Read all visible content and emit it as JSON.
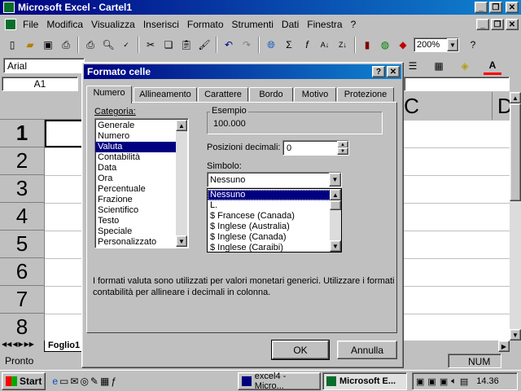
{
  "app": {
    "title": "Microsoft Excel - Cartel1"
  },
  "menu": [
    "File",
    "Modifica",
    "Visualizza",
    "Inserisci",
    "Formato",
    "Strumenti",
    "Dati",
    "Finestra",
    "?"
  ],
  "toolbar": {
    "zoom": "200%"
  },
  "formatbar": {
    "font": "Arial"
  },
  "namebox": "A1",
  "columns": [
    "C",
    "D"
  ],
  "rows": [
    "1",
    "2",
    "3",
    "4",
    "5",
    "6",
    "7",
    "8"
  ],
  "sheet_tab": "Foglio1",
  "statusbar": {
    "left": "Pronto",
    "num": "NUM"
  },
  "dialog": {
    "title": "Formato celle",
    "tabs": [
      "Numero",
      "Allineamento",
      "Carattere",
      "Bordo",
      "Motivo",
      "Protezione"
    ],
    "category_label": "Categoria:",
    "categories": [
      "Generale",
      "Numero",
      "Valuta",
      "Contabilità",
      "Data",
      "Ora",
      "Percentuale",
      "Frazione",
      "Scientifico",
      "Testo",
      "Speciale",
      "Personalizzato"
    ],
    "example_label": "Esempio",
    "example_value": "100.000",
    "decimals_label": "Posizioni decimali:",
    "decimals_value": "0",
    "symbol_label": "Simbolo:",
    "symbol_value": "Nessuno",
    "symbol_options": [
      "Nessuno",
      "L.",
      "$ Francese (Canada)",
      "$ Inglese (Australia)",
      "$ Inglese (Canada)",
      "$ Inglese (Caraibi)"
    ],
    "description": "I formati valuta sono utilizzati per valori  monetari generici. Utilizzare i formati contabilità per allineare i decimali in colonna.",
    "ok": "OK",
    "cancel": "Annulla"
  },
  "taskbar": {
    "start": "Start",
    "tasks": [
      "excel4 - Micro...",
      "Microsoft E..."
    ],
    "clock": "14.36"
  }
}
